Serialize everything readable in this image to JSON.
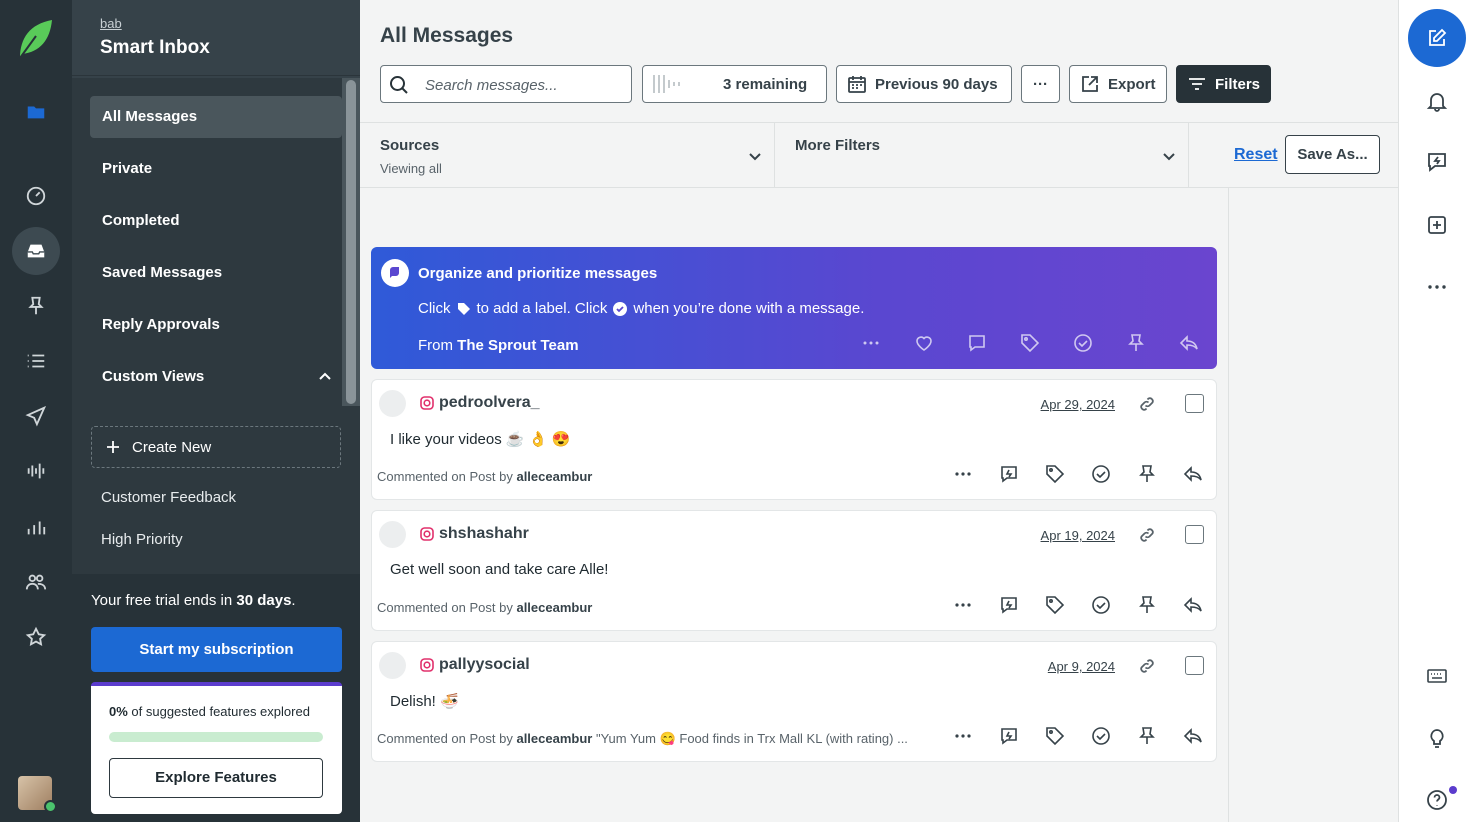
{
  "nav": {
    "workspace": "bab",
    "title": "Smart Inbox",
    "items": [
      {
        "label": "All Messages"
      },
      {
        "label": "Private"
      },
      {
        "label": "Completed"
      },
      {
        "label": "Saved Messages"
      },
      {
        "label": "Reply Approvals"
      },
      {
        "label": "Custom Views"
      }
    ],
    "create_new": "Create New",
    "custom_views": [
      "Customer Feedback",
      "High Priority"
    ],
    "trial_prefix": "Your free trial ends in ",
    "trial_days": "30 days",
    "trial_suffix": ".",
    "subscribe": "Start my subscription",
    "explore_pct": "0%",
    "explore_text": " of suggested features explored",
    "explore_progress": 0,
    "explore_button": "Explore Features"
  },
  "main": {
    "title": "All Messages",
    "search_placeholder": "Search messages...",
    "remaining": "3 remaining",
    "date_range": "Previous 90 days",
    "more": "···",
    "export": "Export",
    "filters": "Filters",
    "sources_label": "Sources",
    "sources_value": "Viewing all",
    "more_filters": "More Filters",
    "reset": "Reset",
    "save_as": "Save As..."
  },
  "promo": {
    "title": "Organize and prioritize messages",
    "body_1": "Click",
    "body_2": "to add a label. Click",
    "body_3": "when you’re done with a message.",
    "from_prefix": "From ",
    "from_name": "The Sprout Team"
  },
  "messages": [
    {
      "handle": "pedroolvera_",
      "date": "Apr 29, 2024",
      "body": "I like your videos ☕ 👌 😍",
      "meta_prefix": "Commented on Post by ",
      "meta_author": "alleceambur",
      "meta_suffix": ""
    },
    {
      "handle": "shshashahr",
      "date": "Apr 19, 2024",
      "body": "Get well soon and take care Alle!",
      "meta_prefix": "Commented on Post by ",
      "meta_author": "alleceambur",
      "meta_suffix": ""
    },
    {
      "handle": "pallyysocial",
      "date": "Apr 9, 2024",
      "body": "Delish! 🍜",
      "meta_prefix": "Commented on Post by ",
      "meta_author": "alleceambur",
      "meta_suffix": " \"Yum Yum 😋 Food finds in Trx Mall KL (with rating) ..."
    }
  ],
  "colors": {
    "brand_blue": "#1c69d3",
    "sidebar_dark": "#273238",
    "nav_bg": "#364249",
    "promo_purple": "#5a47d0",
    "success_green": "#4bc36d"
  }
}
